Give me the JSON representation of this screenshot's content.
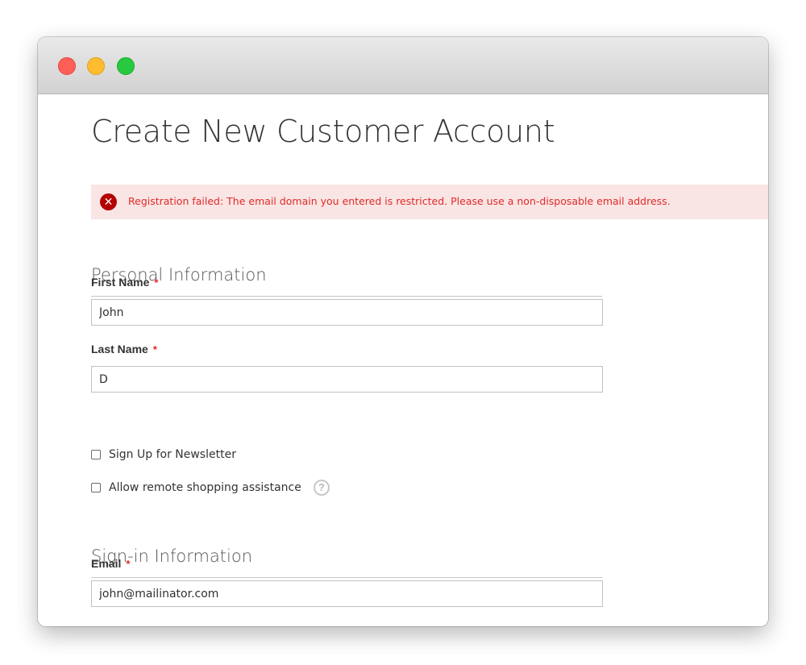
{
  "window": {
    "controls": [
      "close",
      "minimize",
      "zoom"
    ]
  },
  "page": {
    "title": "Create New Customer Account"
  },
  "alert": {
    "icon": "error-icon",
    "message": "Registration failed: The email domain you entered is restricted. Please use a non-disposable email address.",
    "color": "#e02b27",
    "background": "#fae5e5"
  },
  "personal_info": {
    "legend": "Personal Information",
    "first_name": {
      "label": "First Name",
      "required_mark": "*",
      "value": "John"
    },
    "last_name": {
      "label": "Last Name",
      "required_mark": "*",
      "value": "D"
    },
    "newsletter": {
      "label": "Sign Up for Newsletter",
      "checked": false
    },
    "remote_assistance": {
      "label": "Allow remote shopping assistance",
      "checked": false,
      "help_icon": "?"
    }
  },
  "signin_info": {
    "legend": "Sign-in Information",
    "email": {
      "label": "Email",
      "required_mark": "*",
      "value": "john@mailinator.com"
    }
  }
}
